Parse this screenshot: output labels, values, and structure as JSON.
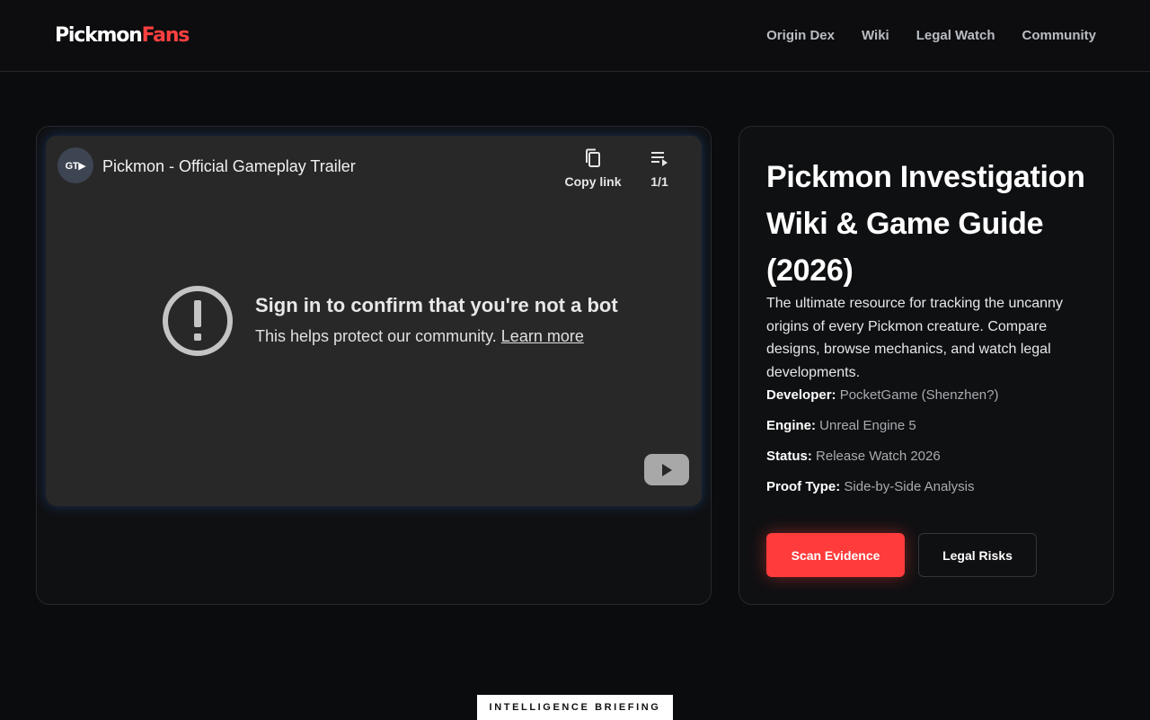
{
  "header": {
    "logo_part1": "Pickmon",
    "logo_part2": "Fans",
    "nav": [
      {
        "label": "Origin Dex"
      },
      {
        "label": "Wiki"
      },
      {
        "label": "Legal Watch"
      },
      {
        "label": "Community"
      }
    ]
  },
  "player": {
    "channel_initials": "GT▶",
    "title": "Pickmon - Official Gameplay Trailer",
    "copy_link_label": "Copy link",
    "playlist_label": "1/1",
    "error_title": "Sign in to confirm that you're not a bot",
    "error_message": "This helps protect our community.",
    "learn_more": "Learn more",
    "icons": [
      "copy-icon",
      "playlist-icon",
      "warning-icon",
      "youtube-play-icon"
    ]
  },
  "info": {
    "title": "Pickmon Investigation Wiki & Game Guide (2026)",
    "description": "The ultimate resource for tracking the uncanny origins of every Pickmon creature. Compare designs, browse mechanics, and watch legal developments.",
    "meta": [
      {
        "label": "Developer:",
        "value": "PocketGame (Shenzhen?)"
      },
      {
        "label": "Engine:",
        "value": "Unreal Engine 5"
      },
      {
        "label": "Status:",
        "value": "Release Watch 2026"
      },
      {
        "label": "Proof Type:",
        "value": "Side-by-Side Analysis"
      }
    ],
    "primary_button": "Scan Evidence",
    "secondary_button": "Legal Risks"
  },
  "section_label": "INTELLIGENCE BRIEFING",
  "colors": {
    "accent": "#ff3b3b",
    "background": "#0b0c0e",
    "card": "#0f1012",
    "player": "#282828"
  }
}
